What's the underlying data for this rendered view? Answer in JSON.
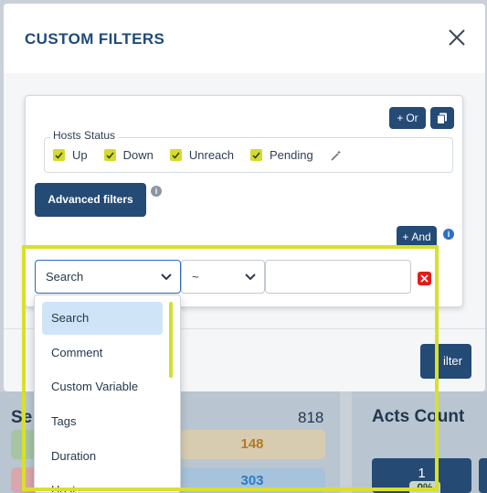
{
  "modal": {
    "title": "CUSTOM FILTERS",
    "or_label": "Or",
    "and_label": "And",
    "hosts_status": {
      "legend": "Hosts Status",
      "options": [
        {
          "label": "Up",
          "checked": true
        },
        {
          "label": "Down",
          "checked": true
        },
        {
          "label": "Unreach",
          "checked": true
        },
        {
          "label": "Pending",
          "checked": true
        }
      ]
    },
    "advanced_filters_label": "Advanced filters",
    "rule": {
      "field_value": "Search",
      "operator_value": "~",
      "value_input": ""
    },
    "dropdown": {
      "options": [
        "Search",
        "Comment",
        "Custom Variable",
        "Tags",
        "Duration",
        "Host"
      ],
      "selected": "Search"
    },
    "filter_button_label": "ilter"
  },
  "background": {
    "panel_title": "Se",
    "panel_count": "818",
    "row1_value": "148",
    "row2_value": "303",
    "acts_title": "Acts Count",
    "acts_button": "1",
    "acts_percent": "0%"
  },
  "colors": {
    "primary": "#244a76",
    "accent_yellow": "#d8e02a",
    "danger": "#e31b1b"
  }
}
